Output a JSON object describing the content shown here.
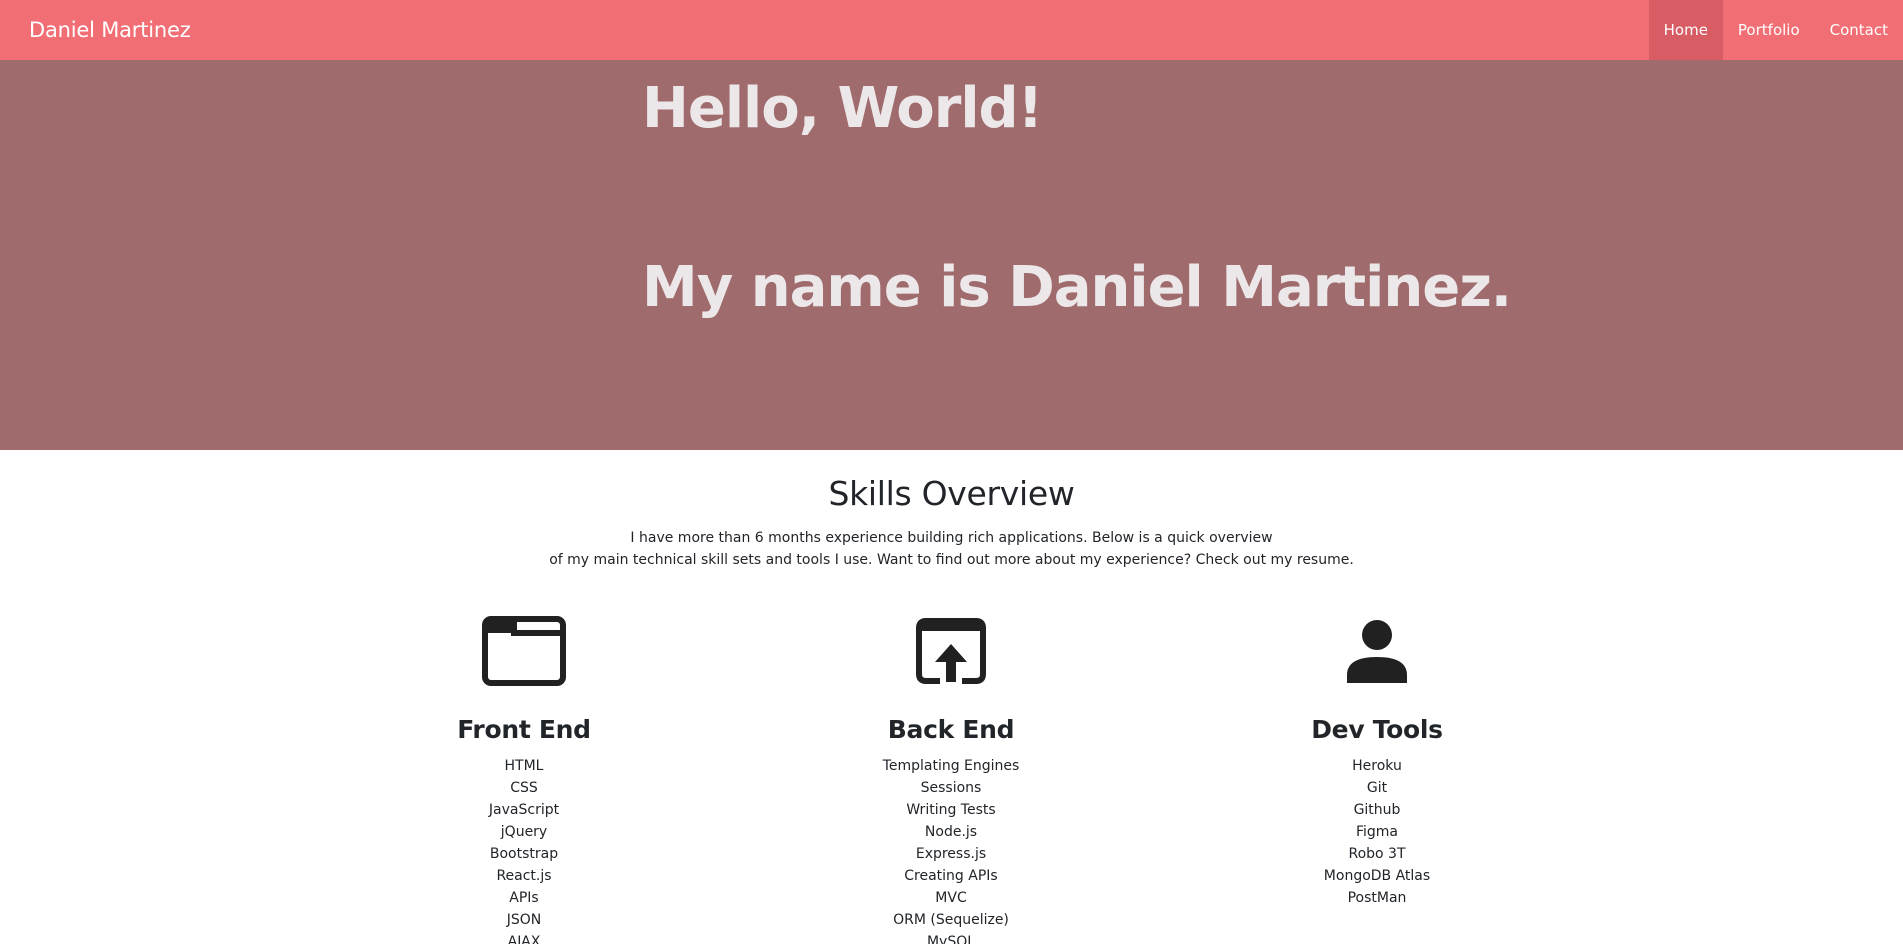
{
  "nav": {
    "brand": "Daniel Martinez",
    "links": [
      "Home",
      "Portfolio",
      "Contact"
    ]
  },
  "hero": {
    "line1": "Hello, World!",
    "line2": "My name is Daniel Martinez."
  },
  "skills": {
    "title": "Skills Overview",
    "intro_line1": "I have more than 6 months experience building rich applications. Below is a quick overview",
    "intro_line2": "of my main technical skill sets and tools I use. Want to find out more about my experience? Check out my resume.",
    "columns": [
      {
        "icon": "browser-window-icon",
        "title": "Front End",
        "items": [
          "HTML",
          "CSS",
          "JavaScript",
          "jQuery",
          "Bootstrap",
          "React.js",
          "APIs",
          "JSON",
          "AJAX"
        ]
      },
      {
        "icon": "open-in-browser-icon",
        "title": "Back End",
        "items": [
          "Templating Engines",
          "Sessions",
          "Writing Tests",
          "Node.js",
          "Express.js",
          "Creating APIs",
          "MVC",
          "ORM (Sequelize)",
          "MySQL"
        ]
      },
      {
        "icon": "person-icon",
        "title": "Dev Tools",
        "items": [
          "Heroku",
          "Git",
          "Github",
          "Figma",
          "Robo 3T",
          "MongoDB Atlas",
          "PostMan"
        ]
      }
    ]
  },
  "colors": {
    "navbar": "#f06e74",
    "nav_active": "#d85c64",
    "hero": "#a06b6c",
    "hero_text": "#ece8ea",
    "icon": "#212121"
  }
}
